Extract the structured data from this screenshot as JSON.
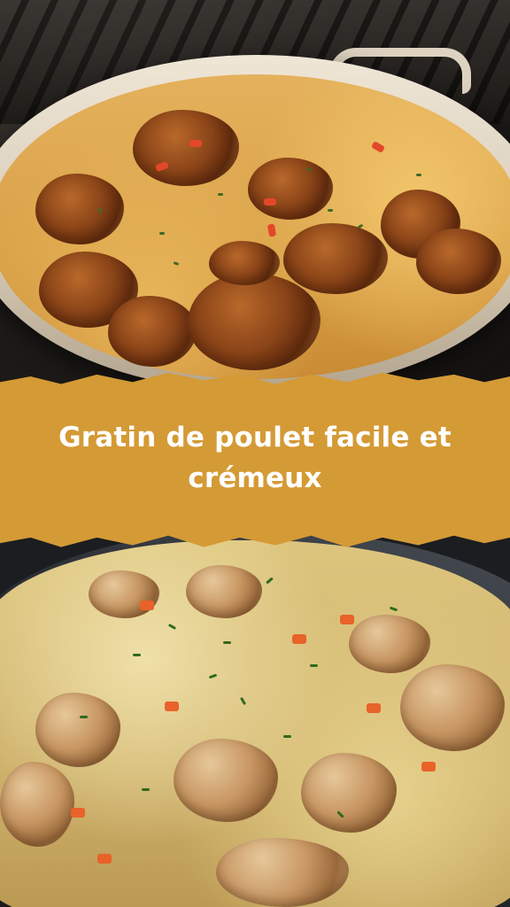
{
  "banner": {
    "title": "Gratin de poulet facile et crémeux"
  },
  "images": {
    "top": "gratin-dish-photo",
    "bottom": "creamy-chicken-skillet-photo"
  },
  "colors": {
    "banner_background": "#d49a35",
    "banner_text": "#ffffff"
  }
}
